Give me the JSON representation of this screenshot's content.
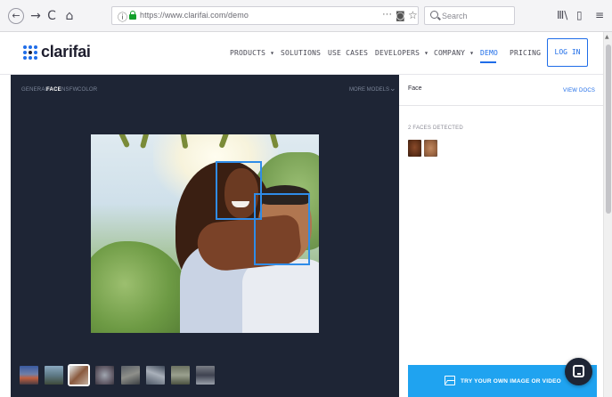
{
  "browser": {
    "back_icon": "←",
    "forward_icon": "→",
    "reload_icon": "C",
    "home_icon": "⌂",
    "info_icon": "ⓘ",
    "url": "https://www.clarifai.com/demo",
    "url_dots": "···",
    "pocket_icon": "◙",
    "star_icon": "☆",
    "search_placeholder": "Search",
    "library_icon": "Ⅲ\\",
    "sidebar_icon": "▯",
    "menu_icon": "≡"
  },
  "site": {
    "logo_text": "clarifai",
    "brand_color": "#1f6de8",
    "nav": [
      {
        "label": "PRODUCTS ▾"
      },
      {
        "label": "SOLUTIONS"
      },
      {
        "label": "USE CASES"
      },
      {
        "label": "DEVELOPERS ▾"
      },
      {
        "label": "COMPANY ▾"
      },
      {
        "label": "DEMO"
      },
      {
        "label": "PRICING"
      }
    ],
    "login_label": "LOG IN"
  },
  "demo": {
    "model_tabs": [
      {
        "label": "GENERAL"
      },
      {
        "label": "FACE"
      },
      {
        "label": "NSFW"
      },
      {
        "label": "COLOR"
      }
    ],
    "active_tab": "FACE",
    "more_models_label": "MORE MODELS",
    "chevron_icon": "⌄",
    "box_color": "#2f8ce8"
  },
  "results": {
    "title": "Face",
    "view_docs": "VIEW DOCS",
    "faces_detected": "2 FACES DETECTED"
  },
  "cta": {
    "label": "TRY YOUR OWN IMAGE OR VIDEO",
    "color": "#1fa3f0"
  }
}
